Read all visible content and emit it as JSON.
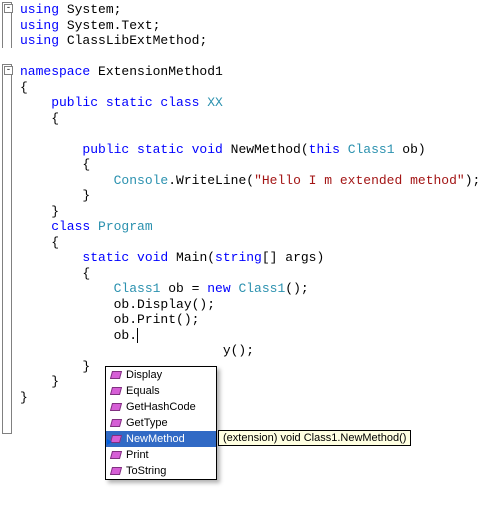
{
  "code": {
    "l1a": "using",
    "l1b": " System;",
    "l2a": "using",
    "l2b": " System.Text;",
    "l3a": "using",
    "l3b": " ClassLibExtMethod;",
    "l5a": "namespace",
    "l5b": " ExtensionMethod1",
    "l6": "{",
    "l7a": "    public",
    "l7b": " static",
    "l7c": " class",
    "l7d": " XX",
    "l8": "    {",
    "l10a": "        public",
    "l10b": " static",
    "l10c": " void",
    "l10d": " NewMethod(",
    "l10e": "this",
    "l10f": " Class1",
    "l10g": " ob)",
    "l11": "        {",
    "l12a": "            Console",
    "l12b": ".WriteLine(",
    "l12c": "\"Hello I m extended method\"",
    "l12d": ");",
    "l13": "        }",
    "l14": "    }",
    "l15a": "    class",
    "l15b": " Program",
    "l16": "    {",
    "l17a": "        static",
    "l17b": " void",
    "l17c": " Main(",
    "l17d": "string",
    "l17e": "[] args)",
    "l18": "        {",
    "l19a": "            Class1",
    "l19b": " ob = ",
    "l19c": "new",
    "l19d": " Class1",
    "l19e": "();",
    "l20": "            ob.Display();",
    "l21": "            ob.Print();",
    "l22": "            ob.",
    "l23": "                          y();",
    "l24": "        }",
    "l25": "    }",
    "l26": "}"
  },
  "intellisense": {
    "items": [
      {
        "label": "Display",
        "ext": false
      },
      {
        "label": "Equals",
        "ext": false
      },
      {
        "label": "GetHashCode",
        "ext": false
      },
      {
        "label": "GetType",
        "ext": false
      },
      {
        "label": "NewMethod",
        "ext": true
      },
      {
        "label": "Print",
        "ext": false
      },
      {
        "label": "ToString",
        "ext": false
      }
    ],
    "selected_index": 4,
    "tooltip": "(extension) void Class1.NewMethod()"
  }
}
